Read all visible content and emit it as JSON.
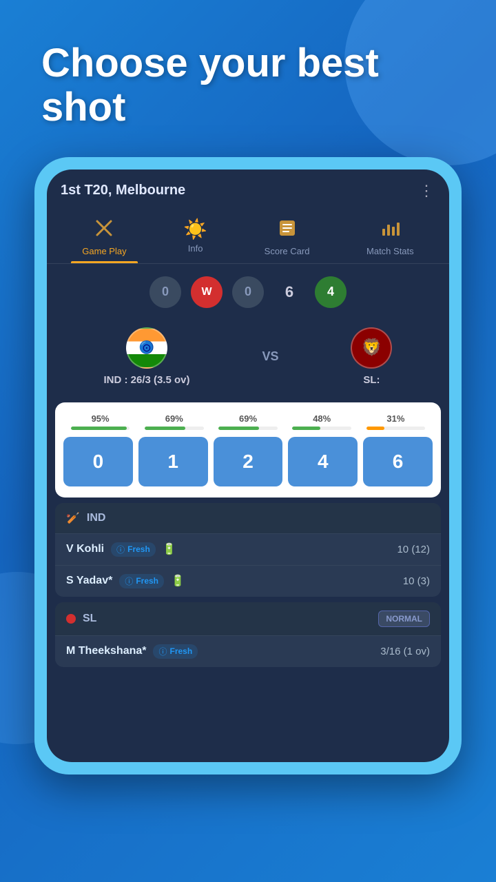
{
  "hero": {
    "text": "Choose your best shot"
  },
  "match": {
    "title": "1st T20, Melbourne",
    "menu_icon": "⋮"
  },
  "nav": {
    "tabs": [
      {
        "id": "gameplay",
        "label": "Game Play",
        "icon": "🏏",
        "active": true
      },
      {
        "id": "info",
        "label": "Info",
        "icon": "🌤",
        "active": false
      },
      {
        "id": "scorecard",
        "label": "Score Card",
        "icon": "📋",
        "active": false
      },
      {
        "id": "matchstats",
        "label": "Match Stats",
        "icon": "📊",
        "active": false
      }
    ]
  },
  "score_balls": [
    {
      "value": "0",
      "type": "gray"
    },
    {
      "value": "W",
      "type": "red"
    },
    {
      "value": "0",
      "type": "gray"
    },
    {
      "value": "6",
      "type": "plain"
    },
    {
      "value": "4",
      "type": "green"
    }
  ],
  "teams": {
    "home": {
      "name": "IND",
      "score": "IND : 26/3 (3.5 ov)",
      "flag": "india"
    },
    "away": {
      "name": "SL",
      "score": "SL:",
      "flag": "srilanka"
    },
    "vs_text": "VS"
  },
  "shots": {
    "options": [
      {
        "value": "0",
        "percentage": "95%",
        "bar_pct": 95,
        "bar_color": "green"
      },
      {
        "value": "1",
        "percentage": "69%",
        "bar_pct": 69,
        "bar_color": "green"
      },
      {
        "value": "2",
        "percentage": "69%",
        "bar_pct": 69,
        "bar_color": "green"
      },
      {
        "value": "4",
        "percentage": "48%",
        "bar_pct": 48,
        "bar_color": "green"
      },
      {
        "value": "6",
        "percentage": "31%",
        "bar_pct": 31,
        "bar_color": "orange"
      }
    ]
  },
  "batting_team": {
    "name": "IND",
    "icon": "🏏",
    "players": [
      {
        "name": "V Kohli",
        "status": "Fresh",
        "score": "10 (12)"
      },
      {
        "name": "S Yadav*",
        "status": "Fresh",
        "score": "10 (3)"
      }
    ]
  },
  "bowling_team": {
    "name": "SL",
    "dot_color": "#d32f2f",
    "badge": "NORMAL",
    "players": [
      {
        "name": "M Theekshana*",
        "status": "Fresh",
        "score": "3/16 (1 ov)"
      }
    ]
  }
}
